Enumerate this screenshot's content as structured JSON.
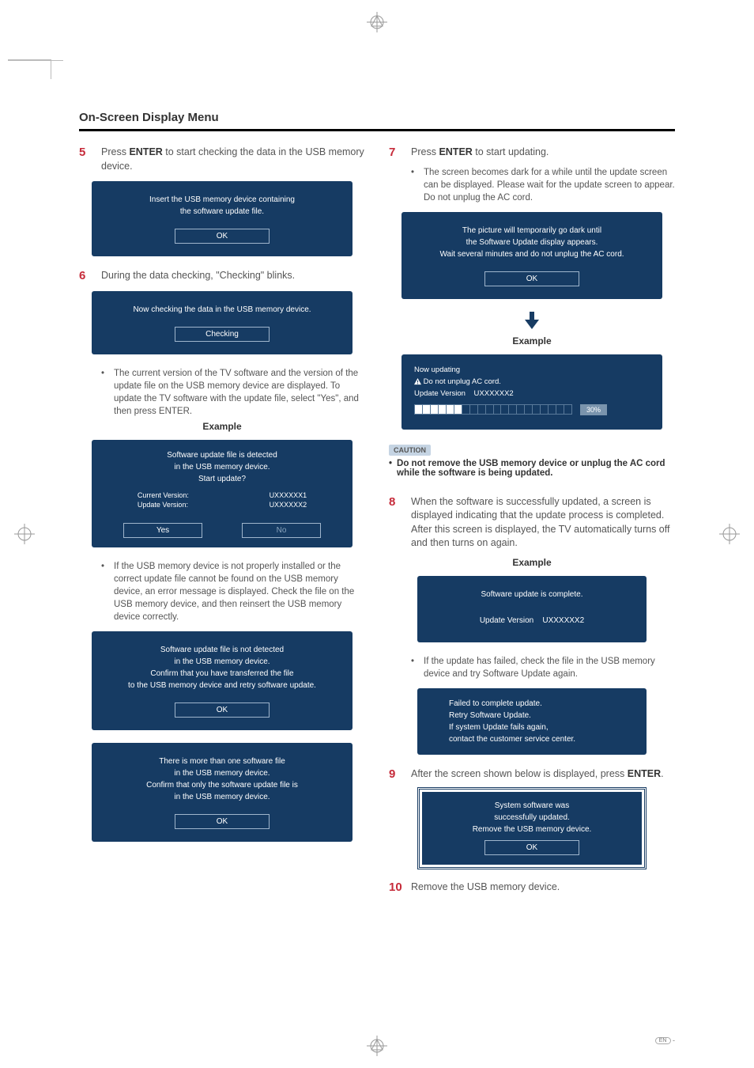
{
  "header": {
    "title": "On-Screen Display Menu"
  },
  "left": {
    "step5": {
      "num": "5",
      "text_a": "Press ",
      "text_b": "ENTER",
      "text_c": " to start checking the data in the USB memory device."
    },
    "panel_insert": {
      "line1": "Insert the USB memory device containing",
      "line2": "the software update file.",
      "btn": "OK"
    },
    "step6": {
      "num": "6",
      "text": "During the data checking, \"Checking\" blinks."
    },
    "panel_checking": {
      "line": "Now checking the data in the USB memory device.",
      "btn": "Checking"
    },
    "bullet_version": "The current version of the TV software and the version of the update file on the USB memory device are displayed. To update the TV software with the update file, select \"Yes\", and then press ENTER.",
    "example1": "Example",
    "panel_detect": {
      "l1": "Software update file is detected",
      "l2": "in the USB memory device.",
      "l3": "Start update?",
      "cv_label": "Current Version:",
      "cv_val": "UXXXXXX1",
      "uv_label": "Update Version:",
      "uv_val": "UXXXXXX2",
      "yes": "Yes",
      "no": "No"
    },
    "bullet_notfound": "If the USB memory device is not properly installed or the correct update file cannot be found on the USB memory device, an error message is displayed. Check the file on the USB memory device, and then reinsert the USB memory device correctly.",
    "panel_nf": {
      "l1": "Software update file is not detected",
      "l2": "in the USB memory device.",
      "l3": "Confirm that you have transferred the file",
      "l4": "to the USB memory device and retry software update.",
      "btn": "OK"
    },
    "panel_multi": {
      "l1": "There is more than one software file",
      "l2": "in the USB memory device.",
      "l3": "Confirm that only the software update file is",
      "l4": "in the USB memory device.",
      "btn": "OK"
    }
  },
  "right": {
    "step7": {
      "num": "7",
      "text_a": "Press ",
      "text_b": "ENTER",
      "text_c": " to start updating."
    },
    "bullet_dark": "The screen becomes dark for a while until the update screen can be displayed. Please wait for the update screen to appear. Do not unplug the AC cord.",
    "panel_dark": {
      "l1": "The picture will temporarily go dark until",
      "l2": "the Software Update display appears.",
      "l3": "Wait several minutes and do not unplug the AC cord.",
      "btn": "OK"
    },
    "example2": "Example",
    "panel_updating": {
      "l1": "Now updating",
      "l2": "Do not unplug AC cord.",
      "uv_label": "Update Version",
      "uv_val": "UXXXXXX2",
      "pct": "30%"
    },
    "caution": {
      "tag": "CAUTION",
      "text": "Do not remove the USB memory device or unplug the AC cord while the software is being updated."
    },
    "step8": {
      "num": "8",
      "text": "When the software is successfully updated, a screen is displayed indicating that the update process is completed.",
      "text2": "After this screen is displayed, the TV automatically turns off and then turns on again."
    },
    "example3": "Example",
    "panel_complete": {
      "l1": "Software update is complete.",
      "uv_label": "Update Version",
      "uv_val": "UXXXXXX2"
    },
    "bullet_fail": "If the update has failed, check the file in the USB memory device and try Software Update again.",
    "panel_fail": {
      "l1": "Failed to complete update.",
      "l2": "Retry Software Update.",
      "l3": "If system Update fails again,",
      "l4": "contact the customer service center."
    },
    "step9": {
      "num": "9",
      "text_a": "After the screen shown below is displayed, press ",
      "text_b": "ENTER",
      "text_c": "."
    },
    "panel_success": {
      "l1": "System software was",
      "l2": "successfully updated.",
      "l3": "Remove the USB memory device.",
      "btn": "OK"
    },
    "step10": {
      "num": "10",
      "text": "Remove the USB memory device."
    }
  },
  "footer": {
    "en": "EN",
    "dash": " -"
  }
}
